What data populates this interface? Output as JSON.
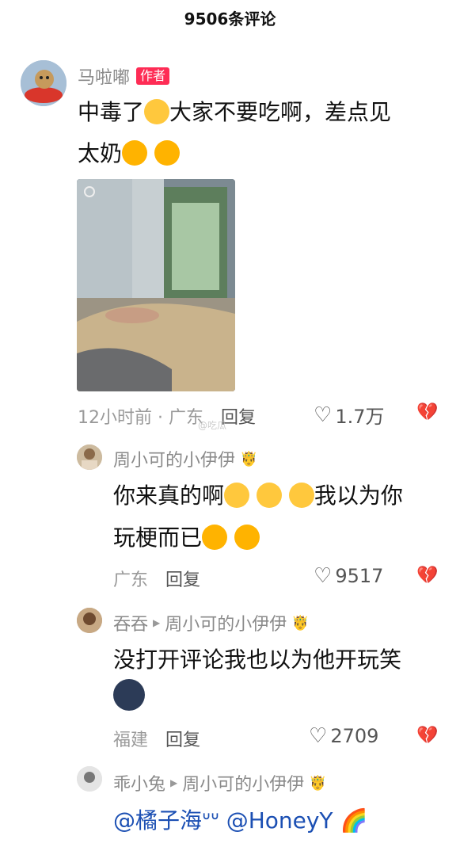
{
  "header": {
    "title": "9506条评论"
  },
  "comments": [
    {
      "author": "马啦嘟",
      "badge": "作者",
      "line1a": "中毒了",
      "line1b": "大家不要吃啊，差点见",
      "line2": "太奶",
      "time_location": "12小时前 · 广东",
      "reply": "回复",
      "likes": "1.7万"
    },
    {
      "author": "周小可的小伊伊",
      "line1a": "你来真的啊",
      "line1b": "我以为你",
      "line2": "玩梗而已",
      "location": "广东",
      "reply": "回复",
      "likes": "9517"
    },
    {
      "author": "吞吞",
      "reply_to": "周小可的小伊伊",
      "line1": "没打开评论我也以为他开玩笑",
      "location": "福建",
      "reply": "回复",
      "likes": "2709"
    },
    {
      "author": "乖小兔",
      "reply_to": "周小可的小伊伊",
      "mention1": "@橘子海ᐡᐡ",
      "mention2": "@HoneyY"
    }
  ],
  "watermark": "@吃瓜"
}
